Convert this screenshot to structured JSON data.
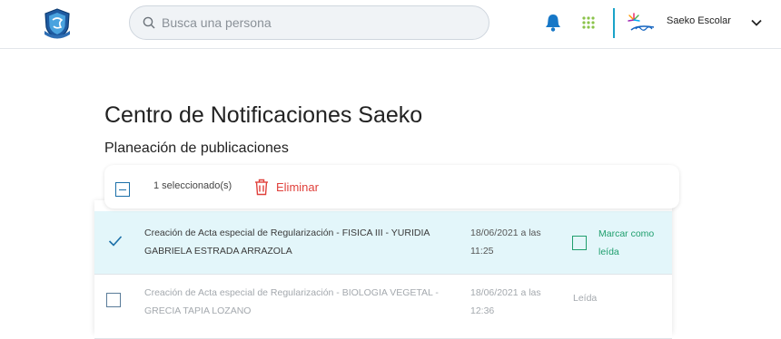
{
  "header": {
    "search": {
      "placeholder": "Busca una persona",
      "value": ""
    },
    "user": {
      "name": "Saeko Escolar"
    },
    "icons": [
      "school-logo-icon",
      "search-icon",
      "bell-icon",
      "apps-grid-icon",
      "saeko-logo-icon",
      "chevron-down-icon"
    ]
  },
  "page": {
    "title": "Centro de Notificaciones Saeko",
    "subtitle": "Planeación de publicaciones"
  },
  "toolbar": {
    "selected_count": "1 seleccionado(s)",
    "delete_label": "Eliminar"
  },
  "notifications": [
    {
      "title": "Creación de Acta especial de Regularización - FISICA III - YURIDIA GABRIELA ESTRADA ARRAZOLA",
      "date": "18/06/2021 a las 11:25",
      "selected": true,
      "status": "Marcar como leída"
    },
    {
      "title": "Creación de Acta especial de Regularización - BIOLOGIA VEGETAL - GRECIA TAPIA LOZANO",
      "date": "18/06/2021 a las 12:36",
      "selected": false,
      "status": "Leída"
    }
  ],
  "colors": {
    "accent_blue": "#1b6fa8",
    "danger": "#e0403b",
    "success": "#1f9e6d",
    "selected_row": "#e3f6fa",
    "divider": "#1aa3c8"
  }
}
